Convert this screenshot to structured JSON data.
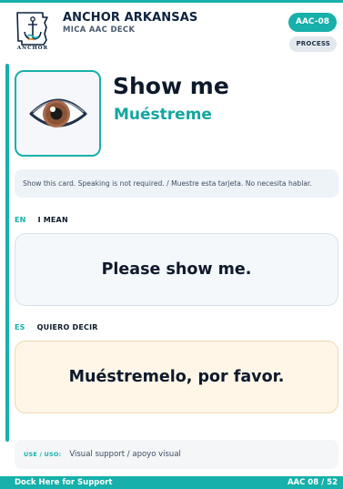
{
  "header": {
    "brand_title": "ANCHOR ARKANSAS",
    "brand_subtitle": "MICA AAC DECK",
    "logo_text": "ANCHOR",
    "card_code": "AAC-08",
    "category_pill": "PROCESS"
  },
  "card": {
    "symbol_icon": "eye-icon",
    "word_en": "Show me",
    "word_es": "Muéstreme",
    "instruction": "Show this card. Speaking is not required. / Muestre esta tarjeta. No necesita hablar.",
    "en": {
      "code": "EN",
      "label": "I MEAN",
      "phrase": "Please show me."
    },
    "es": {
      "code": "ES",
      "label": "QUIERO DECIR",
      "phrase": "Muéstremelo, por favor."
    },
    "use": {
      "label": "USE / USO:",
      "value": "Visual support / apoyo visual"
    }
  },
  "footer": {
    "left": "Dock Here for Support",
    "right": "AAC 08 / 52"
  },
  "colors": {
    "accent": "#17b0aa",
    "navy": "#0e2340",
    "en_box": "#f4f8fb",
    "es_box": "#fff6e8"
  }
}
